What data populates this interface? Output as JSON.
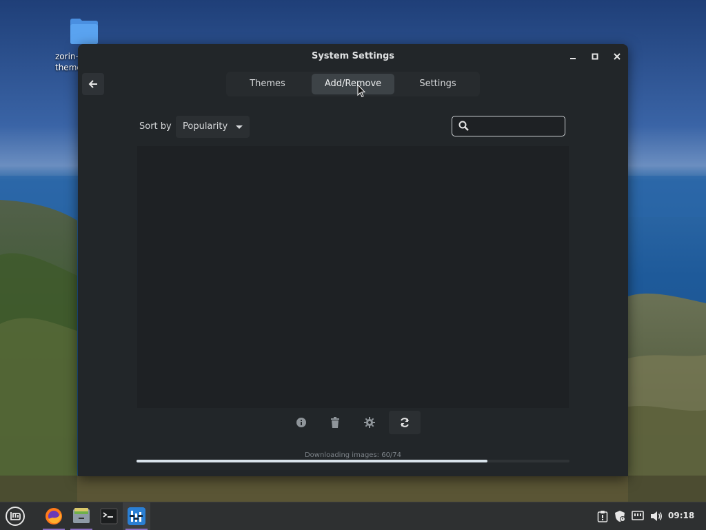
{
  "desktop": {
    "icon_label_line1": "zorin-",
    "icon_label_line2": "theme"
  },
  "window": {
    "title": "System Settings",
    "tabs": [
      {
        "label": "Themes",
        "active": false
      },
      {
        "label": "Add/Remove",
        "active": true
      },
      {
        "label": "Settings",
        "active": false
      }
    ],
    "sort": {
      "label": "Sort by",
      "selected": "Popularity"
    },
    "search": {
      "value": "",
      "placeholder": ""
    },
    "toolbar": [
      "info-icon",
      "trash-icon",
      "gear-icon",
      "refresh-icon"
    ],
    "progress": {
      "text": "Downloading images: 60/74",
      "fraction": 0.8108
    }
  },
  "taskbar": {
    "apps": [
      "mint-menu-icon",
      "firefox-icon",
      "file-manager-icon",
      "terminal-icon",
      "system-settings-icon"
    ],
    "tray": [
      "clipboard-icon",
      "shield-icon",
      "network-icon",
      "volume-icon"
    ],
    "clock": "09:18"
  },
  "colors": {
    "window_bg": "#222629",
    "active_tab": "#3d4347",
    "accent": "#8a6fc0"
  }
}
